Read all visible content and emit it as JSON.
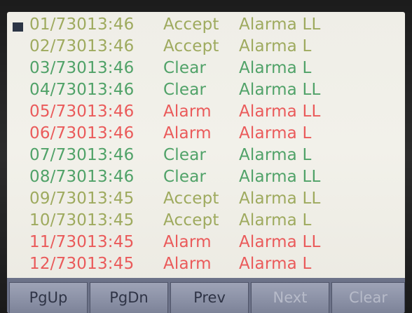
{
  "colors": {
    "accept": "#9eaa5e",
    "clear": "#50a268",
    "alarm": "#ea5a5a",
    "softkey_text": "#2f3446",
    "softkey_dim_text": "#b7bbc9"
  },
  "marker_icon": "selected-row-marker",
  "rows": [
    {
      "ts": "01/73013:46",
      "status": "Accept",
      "msg": "Alarma LL",
      "kind": "accept",
      "selected": true
    },
    {
      "ts": "02/73013:46",
      "status": "Accept",
      "msg": "Alarma L",
      "kind": "accept",
      "selected": false
    },
    {
      "ts": "03/73013:46",
      "status": "Clear",
      "msg": "Alarma L",
      "kind": "clear",
      "selected": false
    },
    {
      "ts": "04/73013:46",
      "status": "Clear",
      "msg": "Alarma LL",
      "kind": "clear",
      "selected": false
    },
    {
      "ts": "05/73013:46",
      "status": "Alarm",
      "msg": "Alarma LL",
      "kind": "alarm",
      "selected": false
    },
    {
      "ts": "06/73013:46",
      "status": "Alarm",
      "msg": "Alarma L",
      "kind": "alarm",
      "selected": false
    },
    {
      "ts": "07/73013:46",
      "status": "Clear",
      "msg": "Alarma L",
      "kind": "clear",
      "selected": false
    },
    {
      "ts": "08/73013:46",
      "status": "Clear",
      "msg": "Alarma LL",
      "kind": "clear",
      "selected": false
    },
    {
      "ts": "09/73013:45",
      "status": "Accept",
      "msg": "Alarma LL",
      "kind": "accept",
      "selected": false
    },
    {
      "ts": "10/73013:45",
      "status": "Accept",
      "msg": "Alarma L",
      "kind": "accept",
      "selected": false
    },
    {
      "ts": "11/73013:45",
      "status": "Alarm",
      "msg": "Alarma LL",
      "kind": "alarm",
      "selected": false
    },
    {
      "ts": "12/73013:45",
      "status": "Alarm",
      "msg": "Alarma L",
      "kind": "alarm",
      "selected": false
    }
  ],
  "softkeys": {
    "pgup": {
      "label": "PgUp",
      "enabled": true
    },
    "pgdn": {
      "label": "PgDn",
      "enabled": true
    },
    "prev": {
      "label": "Prev",
      "enabled": true
    },
    "next": {
      "label": "Next",
      "enabled": false
    },
    "clear": {
      "label": "Clear",
      "enabled": false
    }
  }
}
